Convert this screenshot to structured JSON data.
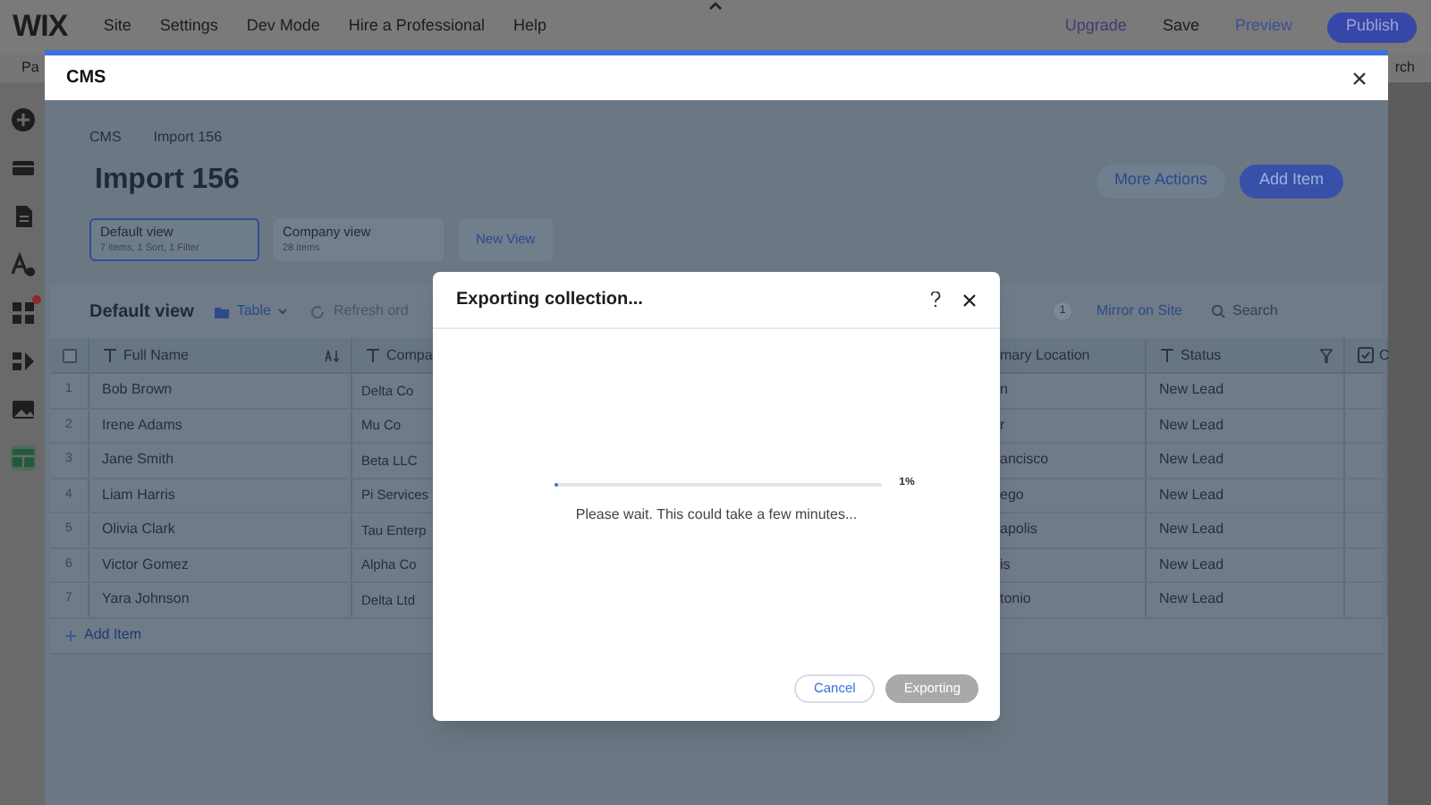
{
  "top_bar": {
    "logo": "WIX",
    "menu": [
      "Site",
      "Settings",
      "Dev Mode",
      "Hire a Professional",
      "Help"
    ],
    "actions": [
      "Upgrade",
      "Save",
      "Preview"
    ],
    "publish": "Publish"
  },
  "sub_bar": {
    "left": "Pa",
    "right": "rch"
  },
  "sidebar": {
    "items": [
      {
        "kind": "add",
        "selected": false,
        "notification": false
      },
      {
        "kind": "section",
        "selected": false,
        "notification": false
      },
      {
        "kind": "page",
        "selected": false,
        "notification": false
      },
      {
        "kind": "design",
        "selected": false,
        "notification": false
      },
      {
        "kind": "apps",
        "selected": false,
        "notification": true
      },
      {
        "kind": "puzzle",
        "selected": false,
        "notification": false
      },
      {
        "kind": "media",
        "selected": false,
        "notification": false
      },
      {
        "kind": "cms",
        "selected": true,
        "notification": false
      }
    ]
  },
  "cms": {
    "title": "CMS",
    "breadcrumb": [
      "CMS",
      "Import 156"
    ],
    "heading": "Import 156",
    "views": [
      {
        "name": "Default view",
        "summary": "7 items, 1 Sort, 1 Filter",
        "selected": true
      },
      {
        "name": "Company view",
        "summary": "28 items",
        "selected": false
      }
    ],
    "new_view": "New View",
    "more_actions": "More Actions",
    "add_item": "Add Item",
    "toolbar": {
      "view_title": "Default view",
      "layout": "Table",
      "refresh": "Refresh ord",
      "badge": "1",
      "mirror": "Mirror on Site",
      "search_placeholder": "Search"
    },
    "table": {
      "select_all": {
        "checked": false
      },
      "columns": [
        {
          "kind": "sorted",
          "label": "Full Name"
        },
        {
          "kind": "text",
          "label": "Compa"
        },
        {
          "kind": "cut",
          "label": "mary Location"
        },
        {
          "kind": "filtered",
          "label": "Status"
        },
        {
          "kind": "boolean",
          "label": "C"
        }
      ],
      "rows": [
        {
          "number": "1",
          "cells": [
            "Bob Brown",
            "Delta Co",
            "n",
            "New Lead"
          ]
        },
        {
          "number": "2",
          "cells": [
            "Irene Adams",
            "Mu Co",
            "r",
            "New Lead"
          ]
        },
        {
          "number": "3",
          "cells": [
            "Jane Smith",
            "Beta LLC",
            "ancisco",
            "New Lead"
          ]
        },
        {
          "number": "4",
          "cells": [
            "Liam Harris",
            "Pi Services",
            "ego",
            "New Lead"
          ]
        },
        {
          "number": "5",
          "cells": [
            "Olivia Clark",
            "Tau Enterp",
            "apolis",
            "New Lead"
          ]
        },
        {
          "number": "6",
          "cells": [
            "Victor Gomez",
            "Alpha Co",
            "is",
            "New Lead"
          ]
        },
        {
          "number": "7",
          "cells": [
            "Yara Johnson",
            "Delta Ltd",
            "tonio",
            "New Lead"
          ]
        }
      ],
      "add_item": "Add Item"
    }
  },
  "dialog": {
    "title": "Exporting collection...",
    "progress": {
      "level": 0.01,
      "reading": "1%"
    },
    "message": "Please wait. This could take a few minutes...",
    "buttons": [
      {
        "label": "Cancel",
        "kind": "secondary",
        "disabled": false
      },
      {
        "label": "Exporting",
        "kind": "primary",
        "disabled": true
      }
    ]
  }
}
